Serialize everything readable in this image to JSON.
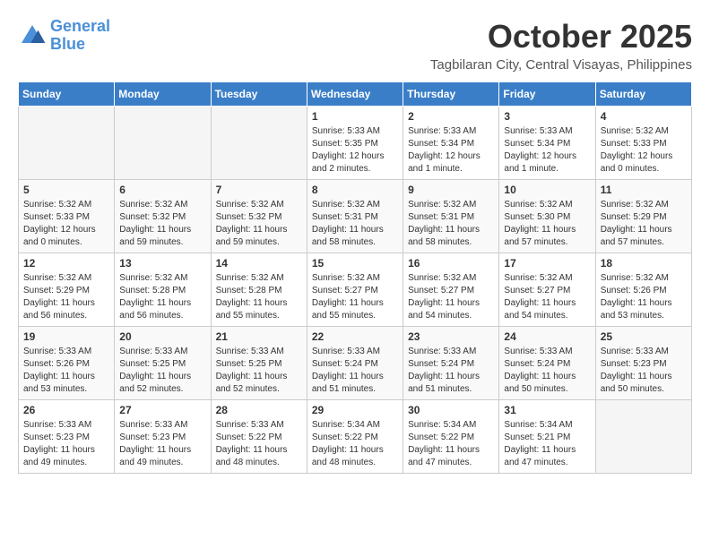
{
  "header": {
    "logo_line1": "General",
    "logo_line2": "Blue",
    "month_title": "October 2025",
    "subtitle": "Tagbilaran City, Central Visayas, Philippines"
  },
  "days_of_week": [
    "Sunday",
    "Monday",
    "Tuesday",
    "Wednesday",
    "Thursday",
    "Friday",
    "Saturday"
  ],
  "weeks": [
    [
      {
        "day": "",
        "empty": true
      },
      {
        "day": "",
        "empty": true
      },
      {
        "day": "",
        "empty": true
      },
      {
        "day": "1",
        "sunrise": "Sunrise: 5:33 AM",
        "sunset": "Sunset: 5:35 PM",
        "daylight": "Daylight: 12 hours and 2 minutes."
      },
      {
        "day": "2",
        "sunrise": "Sunrise: 5:33 AM",
        "sunset": "Sunset: 5:34 PM",
        "daylight": "Daylight: 12 hours and 1 minute."
      },
      {
        "day": "3",
        "sunrise": "Sunrise: 5:33 AM",
        "sunset": "Sunset: 5:34 PM",
        "daylight": "Daylight: 12 hours and 1 minute."
      },
      {
        "day": "4",
        "sunrise": "Sunrise: 5:32 AM",
        "sunset": "Sunset: 5:33 PM",
        "daylight": "Daylight: 12 hours and 0 minutes."
      }
    ],
    [
      {
        "day": "5",
        "sunrise": "Sunrise: 5:32 AM",
        "sunset": "Sunset: 5:33 PM",
        "daylight": "Daylight: 12 hours and 0 minutes."
      },
      {
        "day": "6",
        "sunrise": "Sunrise: 5:32 AM",
        "sunset": "Sunset: 5:32 PM",
        "daylight": "Daylight: 11 hours and 59 minutes."
      },
      {
        "day": "7",
        "sunrise": "Sunrise: 5:32 AM",
        "sunset": "Sunset: 5:32 PM",
        "daylight": "Daylight: 11 hours and 59 minutes."
      },
      {
        "day": "8",
        "sunrise": "Sunrise: 5:32 AM",
        "sunset": "Sunset: 5:31 PM",
        "daylight": "Daylight: 11 hours and 58 minutes."
      },
      {
        "day": "9",
        "sunrise": "Sunrise: 5:32 AM",
        "sunset": "Sunset: 5:31 PM",
        "daylight": "Daylight: 11 hours and 58 minutes."
      },
      {
        "day": "10",
        "sunrise": "Sunrise: 5:32 AM",
        "sunset": "Sunset: 5:30 PM",
        "daylight": "Daylight: 11 hours and 57 minutes."
      },
      {
        "day": "11",
        "sunrise": "Sunrise: 5:32 AM",
        "sunset": "Sunset: 5:29 PM",
        "daylight": "Daylight: 11 hours and 57 minutes."
      }
    ],
    [
      {
        "day": "12",
        "sunrise": "Sunrise: 5:32 AM",
        "sunset": "Sunset: 5:29 PM",
        "daylight": "Daylight: 11 hours and 56 minutes."
      },
      {
        "day": "13",
        "sunrise": "Sunrise: 5:32 AM",
        "sunset": "Sunset: 5:28 PM",
        "daylight": "Daylight: 11 hours and 56 minutes."
      },
      {
        "day": "14",
        "sunrise": "Sunrise: 5:32 AM",
        "sunset": "Sunset: 5:28 PM",
        "daylight": "Daylight: 11 hours and 55 minutes."
      },
      {
        "day": "15",
        "sunrise": "Sunrise: 5:32 AM",
        "sunset": "Sunset: 5:27 PM",
        "daylight": "Daylight: 11 hours and 55 minutes."
      },
      {
        "day": "16",
        "sunrise": "Sunrise: 5:32 AM",
        "sunset": "Sunset: 5:27 PM",
        "daylight": "Daylight: 11 hours and 54 minutes."
      },
      {
        "day": "17",
        "sunrise": "Sunrise: 5:32 AM",
        "sunset": "Sunset: 5:27 PM",
        "daylight": "Daylight: 11 hours and 54 minutes."
      },
      {
        "day": "18",
        "sunrise": "Sunrise: 5:32 AM",
        "sunset": "Sunset: 5:26 PM",
        "daylight": "Daylight: 11 hours and 53 minutes."
      }
    ],
    [
      {
        "day": "19",
        "sunrise": "Sunrise: 5:33 AM",
        "sunset": "Sunset: 5:26 PM",
        "daylight": "Daylight: 11 hours and 53 minutes."
      },
      {
        "day": "20",
        "sunrise": "Sunrise: 5:33 AM",
        "sunset": "Sunset: 5:25 PM",
        "daylight": "Daylight: 11 hours and 52 minutes."
      },
      {
        "day": "21",
        "sunrise": "Sunrise: 5:33 AM",
        "sunset": "Sunset: 5:25 PM",
        "daylight": "Daylight: 11 hours and 52 minutes."
      },
      {
        "day": "22",
        "sunrise": "Sunrise: 5:33 AM",
        "sunset": "Sunset: 5:24 PM",
        "daylight": "Daylight: 11 hours and 51 minutes."
      },
      {
        "day": "23",
        "sunrise": "Sunrise: 5:33 AM",
        "sunset": "Sunset: 5:24 PM",
        "daylight": "Daylight: 11 hours and 51 minutes."
      },
      {
        "day": "24",
        "sunrise": "Sunrise: 5:33 AM",
        "sunset": "Sunset: 5:24 PM",
        "daylight": "Daylight: 11 hours and 50 minutes."
      },
      {
        "day": "25",
        "sunrise": "Sunrise: 5:33 AM",
        "sunset": "Sunset: 5:23 PM",
        "daylight": "Daylight: 11 hours and 50 minutes."
      }
    ],
    [
      {
        "day": "26",
        "sunrise": "Sunrise: 5:33 AM",
        "sunset": "Sunset: 5:23 PM",
        "daylight": "Daylight: 11 hours and 49 minutes."
      },
      {
        "day": "27",
        "sunrise": "Sunrise: 5:33 AM",
        "sunset": "Sunset: 5:23 PM",
        "daylight": "Daylight: 11 hours and 49 minutes."
      },
      {
        "day": "28",
        "sunrise": "Sunrise: 5:33 AM",
        "sunset": "Sunset: 5:22 PM",
        "daylight": "Daylight: 11 hours and 48 minutes."
      },
      {
        "day": "29",
        "sunrise": "Sunrise: 5:34 AM",
        "sunset": "Sunset: 5:22 PM",
        "daylight": "Daylight: 11 hours and 48 minutes."
      },
      {
        "day": "30",
        "sunrise": "Sunrise: 5:34 AM",
        "sunset": "Sunset: 5:22 PM",
        "daylight": "Daylight: 11 hours and 47 minutes."
      },
      {
        "day": "31",
        "sunrise": "Sunrise: 5:34 AM",
        "sunset": "Sunset: 5:21 PM",
        "daylight": "Daylight: 11 hours and 47 minutes."
      },
      {
        "day": "",
        "empty": true
      }
    ]
  ]
}
